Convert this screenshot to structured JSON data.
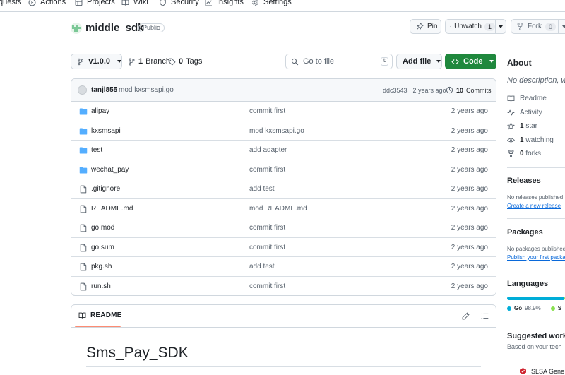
{
  "topnav": {
    "items": [
      {
        "label": "quests",
        "icon": "none"
      },
      {
        "label": "Actions",
        "icon": "play-icon"
      },
      {
        "label": "Projects",
        "icon": "table-icon"
      },
      {
        "label": "Wiki",
        "icon": "book-icon"
      },
      {
        "label": "Security",
        "icon": "shield-icon"
      },
      {
        "label": "Insights",
        "icon": "graph-icon"
      },
      {
        "label": "Settings",
        "icon": "gear-icon"
      }
    ]
  },
  "repo": {
    "name": "middle_sdk",
    "visibility": "Public",
    "pin_label": "Pin",
    "unwatch_label": "Unwatch",
    "watch_count": "1",
    "fork_label": "Fork",
    "fork_count": "0"
  },
  "branch_bar": {
    "branch": "v1.0.0",
    "branches_count": "1",
    "branches_label": "Branch",
    "tags_count": "0",
    "tags_label": "Tags",
    "search_placeholder": "Go to file",
    "search_kbd": "t",
    "add_file_label": "Add file",
    "code_label": "Code"
  },
  "latest_commit": {
    "author": "tanjl855",
    "message": "mod kxsmsapi.go",
    "hash_time": "ddc3543 · 2 years ago",
    "commits_count": "10",
    "commits_label": "Commits"
  },
  "files": [
    {
      "name": "alipay",
      "type": "dir",
      "commit": "commit first",
      "date": "2 years ago"
    },
    {
      "name": "kxsmsapi",
      "type": "dir",
      "commit": "mod kxsmsapi.go",
      "date": "2 years ago"
    },
    {
      "name": "test",
      "type": "dir",
      "commit": "add adapter",
      "date": "2 years ago"
    },
    {
      "name": "wechat_pay",
      "type": "dir",
      "commit": "commit first",
      "date": "2 years ago"
    },
    {
      "name": ".gitignore",
      "type": "file",
      "commit": "add test",
      "date": "2 years ago"
    },
    {
      "name": "README.md",
      "type": "file",
      "commit": "mod README.md",
      "date": "2 years ago"
    },
    {
      "name": "go.mod",
      "type": "file",
      "commit": "commit first",
      "date": "2 years ago"
    },
    {
      "name": "go.sum",
      "type": "file",
      "commit": "commit first",
      "date": "2 years ago"
    },
    {
      "name": "pkg.sh",
      "type": "file",
      "commit": "add test",
      "date": "2 years ago"
    },
    {
      "name": "run.sh",
      "type": "file",
      "commit": "commit first",
      "date": "2 years ago"
    }
  ],
  "readme": {
    "tab_label": "README",
    "heading": "Sms_Pay_SDK"
  },
  "sidebar": {
    "about_title": "About",
    "description": "No description, w",
    "readme_label": "Readme",
    "activity_label": "Activity",
    "stars_count": "1",
    "stars_label": "star",
    "watching_count": "1",
    "watching_label": "watching",
    "forks_count": "0",
    "forks_label": "forks",
    "releases_title": "Releases",
    "releases_text": "No releases published",
    "releases_link": "Create a new release",
    "packages_title": "Packages",
    "packages_text": "No packages published",
    "packages_link": "Publish your first packa",
    "languages_title": "Languages",
    "languages": [
      {
        "name": "Go",
        "percent": "98.9%",
        "share": 98.9,
        "color": "#00add8"
      },
      {
        "name": "S",
        "percent": "",
        "share": 1.1,
        "color": "#89e051"
      }
    ],
    "suggested_title": "Suggested workf",
    "suggested_text": "Based on your tech",
    "suggested_item": "SLSA Gene"
  },
  "colors": {
    "accent_green": "#1f883d",
    "folder_blue": "#54aeff",
    "link_blue": "#0969da",
    "readme_tab_underline": "#fd8c73"
  }
}
